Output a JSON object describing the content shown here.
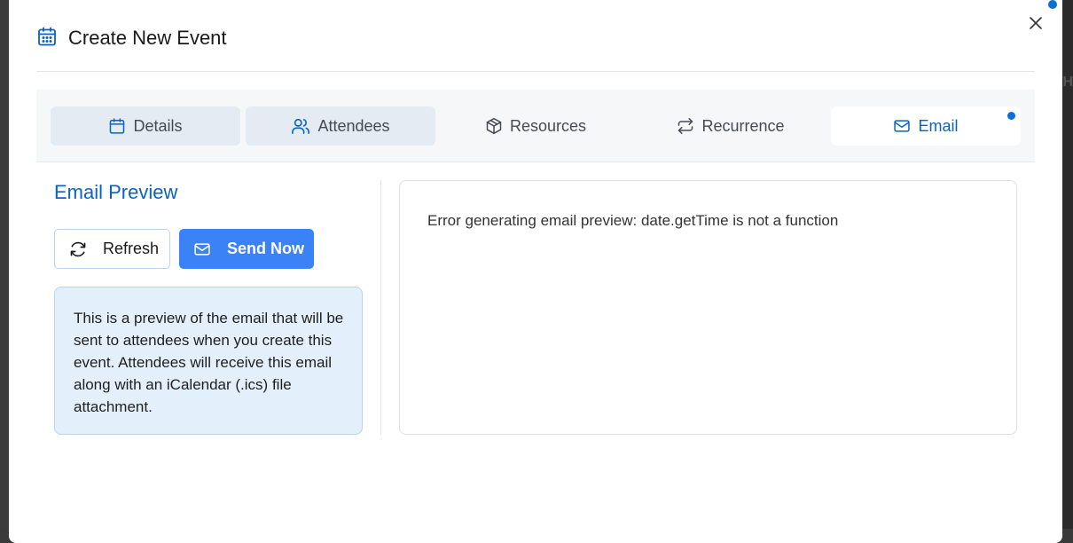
{
  "dialog": {
    "title": "Create New Event",
    "title_icon": "calendar-icon",
    "close_icon": "close-icon"
  },
  "backdrop": {
    "partial_text": "TH"
  },
  "tabs": [
    {
      "label": "Details",
      "icon": "calendar-icon",
      "state": "visited"
    },
    {
      "label": "Attendees",
      "icon": "users-icon",
      "state": "visited"
    },
    {
      "label": "Resources",
      "icon": "box-icon",
      "state": "default"
    },
    {
      "label": "Recurrence",
      "icon": "repeat-icon",
      "state": "default"
    },
    {
      "label": "Email",
      "icon": "mail-icon",
      "state": "active",
      "has_indicator": true
    }
  ],
  "email_preview": {
    "heading": "Email Preview",
    "refresh_label": "Refresh",
    "send_label": "Send Now",
    "info_text": "This is a preview of the email that will be sent to attendees when you create this event. Attendees will receive this email along with an iCalendar (.ics) file attachment.",
    "error_text": "Error generating email preview: date.getTime is not a function"
  },
  "colors": {
    "accent": "#0a63c2",
    "primary_button": "#3b82f6",
    "info_bg": "#e3effa",
    "indicator": "#0a6fd6"
  }
}
